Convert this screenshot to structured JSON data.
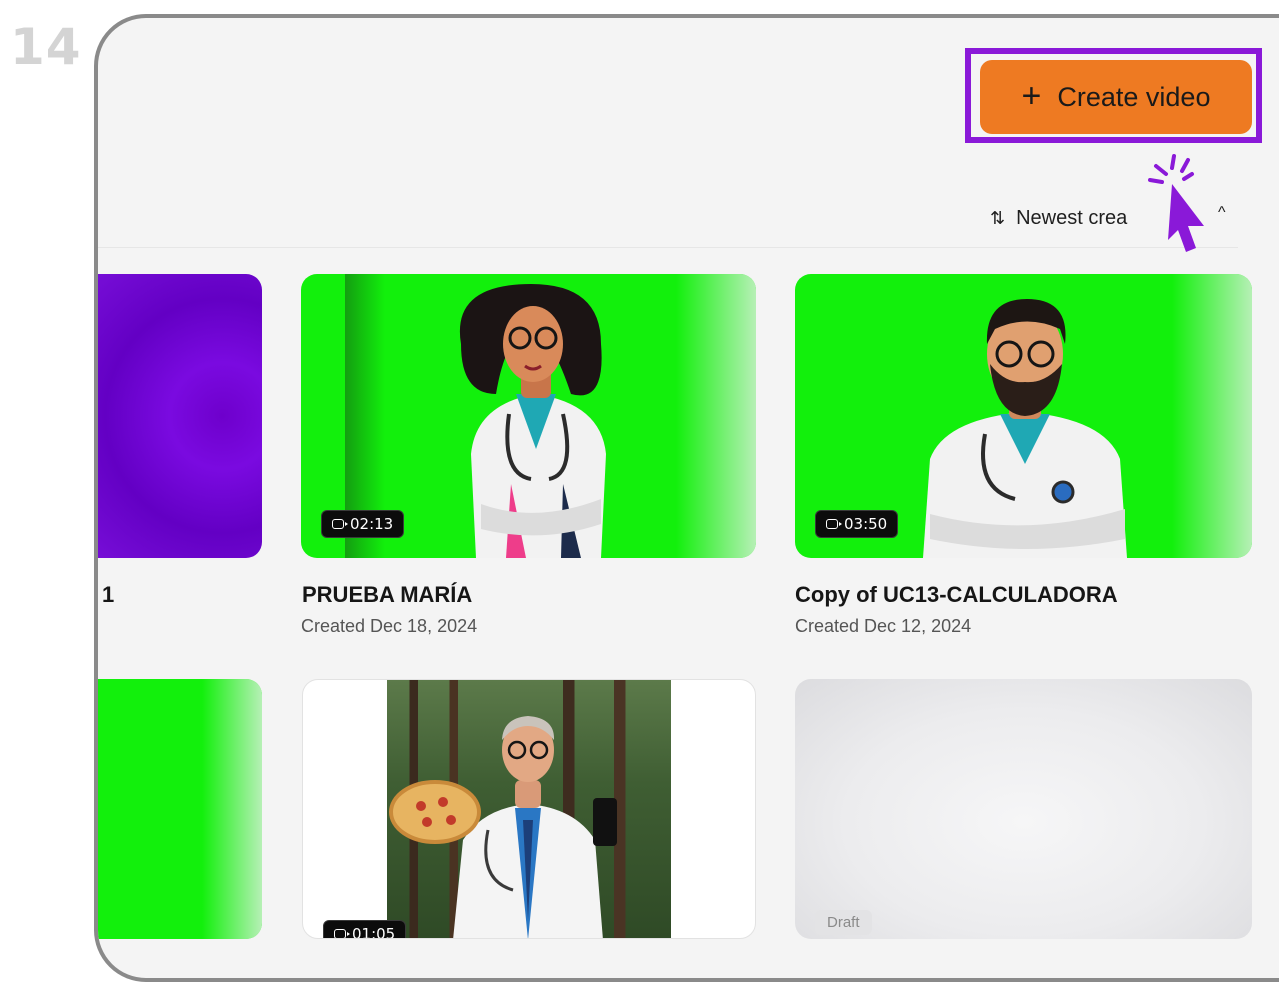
{
  "step": {
    "number": "14"
  },
  "toolbar": {
    "create_label": "Create video",
    "create_plus": "+"
  },
  "sort": {
    "icon": "⇅",
    "label": "Newest crea",
    "chevron": "^"
  },
  "cards": [
    {
      "title": "1",
      "duration": null
    },
    {
      "title": "PRUEBA MARÍA",
      "date": "Created Dec 18, 2024",
      "duration": "02:13"
    },
    {
      "title": "Copy of UC13-CALCULADORA",
      "date": "Created Dec 12, 2024",
      "duration": "03:50"
    },
    {
      "duration": "01:05"
    },
    {
      "status": "Draft"
    }
  ],
  "colors": {
    "accent": "#ee7a22",
    "highlight": "#8a19d8",
    "green_screen": "#12f00c"
  },
  "icons": [
    "plus-icon",
    "sort-icon",
    "chevron-up-icon",
    "video-camera-icon",
    "click-cursor-icon"
  ]
}
